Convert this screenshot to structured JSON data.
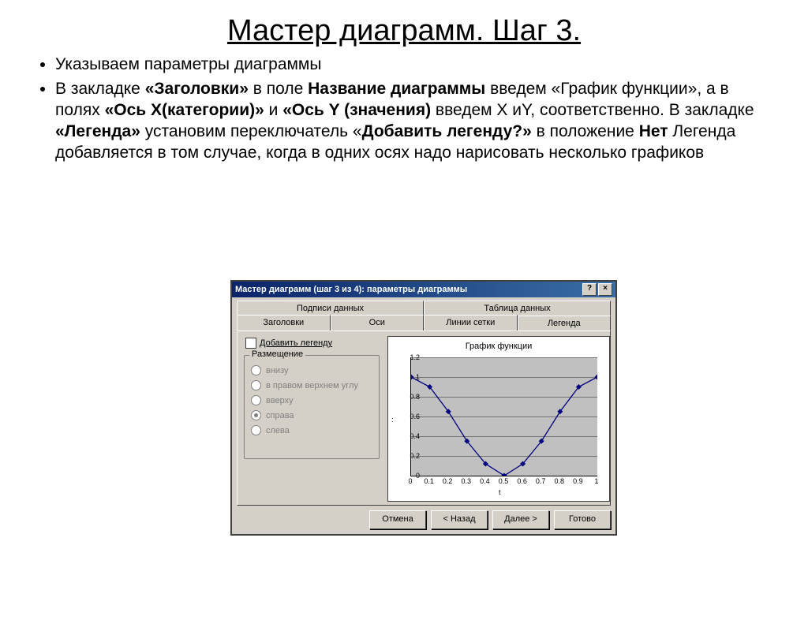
{
  "title": "Мастер диаграмм. Шаг 3.",
  "bullet1": "Указываем параметры диаграммы",
  "wizard": {
    "title": "Мастер диаграмм (шаг 3 из 4): параметры диаграммы",
    "tabs_top": [
      "Подписи данных",
      "Таблица данных"
    ],
    "tabs_bottom": [
      "Заголовки",
      "Оси",
      "Линии сетки",
      "Легенда"
    ],
    "add_legend": "Добавить легенду",
    "placement": "Размещение",
    "radios": [
      "внизу",
      "в правом верхнем углу",
      "вверху",
      "справа",
      "слева"
    ],
    "buttons": {
      "cancel": "Отмена",
      "back": "< Назад",
      "next": "Далее >",
      "finish": "Готово"
    }
  },
  "chart_data": {
    "type": "line",
    "title": "График функции",
    "xlabel": "t",
    "ylabel": ":",
    "x": [
      0,
      0.1,
      0.2,
      0.3,
      0.4,
      0.5,
      0.6,
      0.7,
      0.8,
      0.9,
      1
    ],
    "values": [
      1.0,
      0.9,
      0.65,
      0.35,
      0.12,
      0.0,
      0.12,
      0.35,
      0.65,
      0.9,
      1.0
    ],
    "yticks": [
      0,
      0.2,
      0.4,
      0.6,
      0.8,
      1,
      1.2
    ],
    "ylim": [
      0,
      1.2
    ],
    "xlim": [
      0,
      1
    ]
  }
}
